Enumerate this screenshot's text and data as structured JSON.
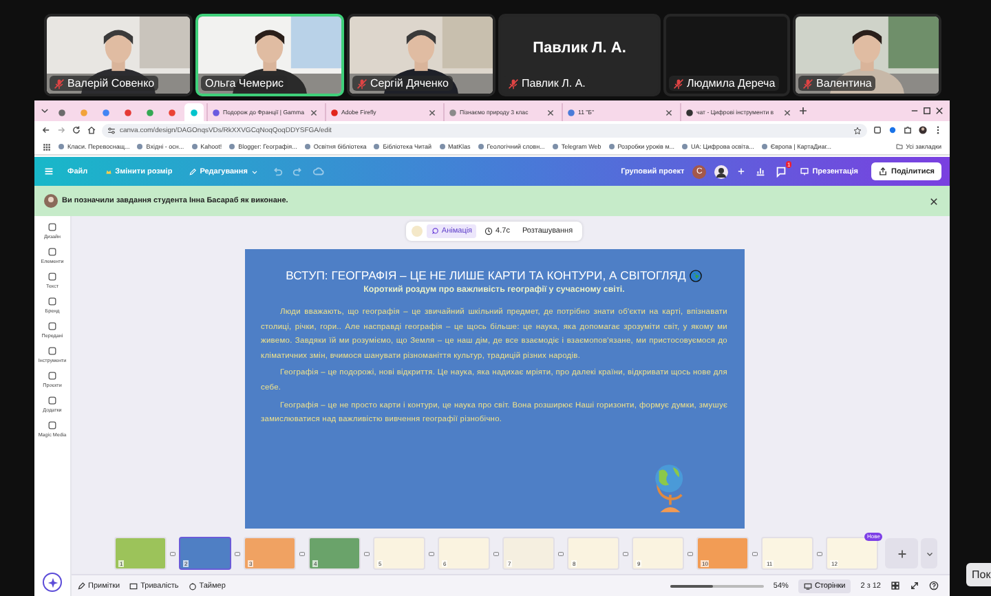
{
  "participants": [
    {
      "name": "Валерій Совенко",
      "kind": "video",
      "muted": true,
      "speaking": false
    },
    {
      "name": "Ольга Чемерис",
      "kind": "video",
      "muted": false,
      "speaking": true
    },
    {
      "name": "Сергій Дяченко",
      "kind": "video",
      "muted": true,
      "speaking": false
    },
    {
      "name": "Павлик Л. А.",
      "kind": "name",
      "display_name": "Павлик Л. А.",
      "muted": true,
      "speaking": false
    },
    {
      "name": "Людмила Дереча",
      "kind": "blank",
      "muted": true,
      "speaking": false
    },
    {
      "name": "Валентина",
      "kind": "video",
      "muted": true,
      "speaking": false
    }
  ],
  "browser": {
    "pinned_tabs": [
      {
        "color": "#6b6b6b",
        "selected": false
      },
      {
        "color": "#f2a33a",
        "selected": false
      },
      {
        "color": "#4285f4",
        "selected": false
      },
      {
        "color": "#e53935",
        "selected": false
      },
      {
        "color": "#34a853",
        "selected": false
      },
      {
        "color": "#ea4335",
        "selected": false
      },
      {
        "color": "#00c4cc",
        "selected": true
      }
    ],
    "tabs": [
      {
        "title": "Подорож до Франції | Gamma",
        "color": "#6a5ae0",
        "selected": false
      },
      {
        "title": "Adobe Firefly",
        "color": "#e1251b",
        "selected": false
      },
      {
        "title": "Пізнаємо природу 3 клас",
        "color": "#8a8a8a",
        "selected": false
      },
      {
        "title": "11 \"Б\"",
        "color": "#4a7bd8",
        "selected": false
      },
      {
        "title": "чат - Цифрові інструменти в",
        "color": "#333333",
        "selected": false
      }
    ],
    "url": "canva.com/design/DAGOnqsVDs/RkXXVGCqNoqQoqDDYSFGA/edit",
    "bookmarks": [
      "Класи. Перевоснащ...",
      "Вхідні - осн...",
      "Kahoot!",
      "Blogger: Географія...",
      "Освітня бібліотека",
      "Бібліотека Читай",
      "MatKlas",
      "Геологічний словн...",
      "Telegram Web",
      "Розробки уроків м...",
      "UA: Цифрова освіта...",
      "Європа | КартаДиаг..."
    ],
    "all_bookmarks": "Усі закладки"
  },
  "canva": {
    "menu": [
      "Файл",
      "Змінити розмір",
      "Редагування"
    ],
    "project": "Груповий проект",
    "avatar_letter": "C",
    "notifications": "1",
    "present": "Презентація",
    "share": "Поділитися",
    "notice": "Ви позначили завдання студента Інна Басараб як виконане.",
    "sidebar": [
      "Дизайн",
      "Елементи",
      "Текст",
      "Бренд",
      "Передані",
      "Інструменти",
      "Проєкти",
      "Додатки",
      "Magic Media"
    ],
    "slide_toolbar": [
      {
        "label": "Анімація",
        "kind": "animation",
        "selected": true
      },
      {
        "label": "4.7с",
        "kind": "duration",
        "selected": false
      },
      {
        "label": "Розташування",
        "kind": "position",
        "selected": false
      }
    ],
    "slide": {
      "title": "ВСТУП: ГЕОГРАФІЯ – ЦЕ НЕ ЛИШЕ КАРТИ ТА КОНТУРИ, А СВІТОГЛЯД",
      "subtitle": "Короткий роздум про важливість географії у сучасному світі.",
      "paragraphs": [
        "Люди вважають, що географія – це звичайний шкільний предмет, де потрібно знати об'єкти на карті, впізнавати столиці, річки, гори.. Але насправді географія – це щось більше: це наука, яка допомагає зрозуміти світ, у якому ми живемо. Завдяки їй ми розуміємо, що Земля – це наш дім, де все взаємодіє і взаємопов'язане, ми пристосовуємося до кліматичних змін, вчимося шанувати різноманіття культур, традицій різних народів.",
        "Географія – це подорожі, нові відкриття. Це наука, яка надихає мріяти, про далекі країни, відкривати щось нове для себе.",
        "Географія – це не просто карти і контури, це наука про світ. Вона розширює Наші горизонти, формує думки, змушує замислюватися над важливістю вивчення географії різнобічно."
      ]
    },
    "pages": [
      {
        "number": "1",
        "color": "#9cc35a",
        "selected": false
      },
      {
        "number": "2",
        "color": "#4f7fc4",
        "selected": true
      },
      {
        "number": "3",
        "color": "#f0a262",
        "selected": false
      },
      {
        "number": "4",
        "color": "#6aa36a",
        "selected": false
      },
      {
        "number": "5",
        "color": "#faf3e0",
        "selected": false
      },
      {
        "number": "6",
        "color": "#faf3e0",
        "selected": false
      },
      {
        "number": "7",
        "color": "#f5efe0",
        "selected": false
      },
      {
        "number": "8",
        "color": "#faf3e0",
        "selected": false
      },
      {
        "number": "9",
        "color": "#faf3e0",
        "selected": false
      },
      {
        "number": "10",
        "color": "#f29c55",
        "selected": false
      },
      {
        "number": "11",
        "color": "#fbf5e2",
        "selected": false
      },
      {
        "number": "12",
        "color": "#fbf5e2",
        "selected": false
      }
    ],
    "new_badge": "Нове",
    "bottom": {
      "notes": "Примітки",
      "duration": "Тривалість",
      "timer": "Таймер",
      "zoom": "54%",
      "zoom_slider": {
        "level": 0.45
      },
      "pages_button": "Сторінки",
      "page_count": "2 з 12"
    }
  },
  "side_button": "Пок"
}
